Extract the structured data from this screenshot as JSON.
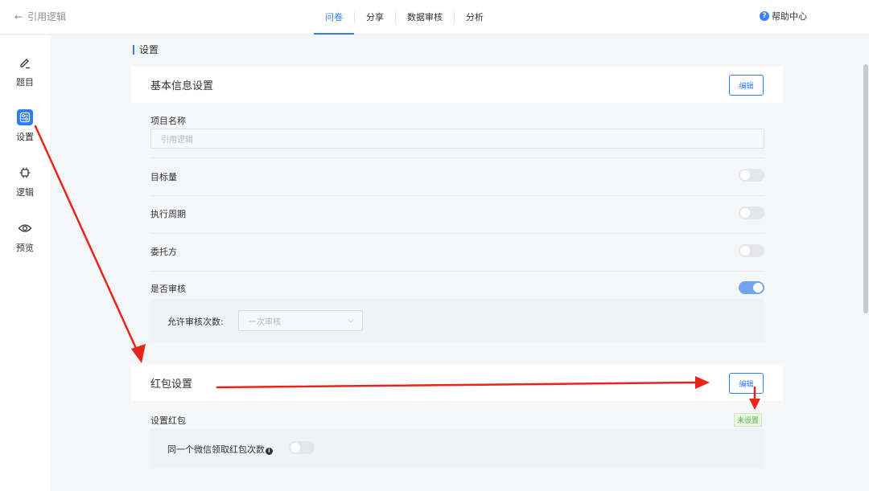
{
  "header": {
    "back_label": "引用逻辑",
    "tabs": [
      {
        "label": "问卷",
        "active": true
      },
      {
        "label": "分享",
        "active": false
      },
      {
        "label": "数据审核",
        "active": false
      },
      {
        "label": "分析",
        "active": false
      }
    ],
    "help_label": "帮助中心"
  },
  "sidebar": {
    "items": [
      {
        "label": "题目",
        "icon": "pencil-icon"
      },
      {
        "label": "设置",
        "icon": "settings-panel-icon",
        "active": true
      },
      {
        "label": "逻辑",
        "icon": "chip-icon"
      },
      {
        "label": "预览",
        "icon": "eye-icon"
      }
    ]
  },
  "main": {
    "section_title": "设置",
    "basic": {
      "title": "基本信息设置",
      "edit_label": "编辑",
      "project_name_label": "项目名称",
      "project_name_placeholder": "引用逻辑",
      "target_label": "目标量",
      "target_on": false,
      "cycle_label": "执行周期",
      "cycle_on": false,
      "client_label": "委托方",
      "client_on": false,
      "review_label": "是否审核",
      "review_on": true,
      "review_times_label": "允许审核次数:",
      "review_times_value": "一次审核"
    },
    "redpacket": {
      "title": "红包设置",
      "edit_label": "编辑",
      "set_label": "设置红包",
      "status_badge": "未设置",
      "wechat_times_label": "同一个微信领取红包次数",
      "wechat_times_on": false
    }
  },
  "colors": {
    "accent": "#2d7df6",
    "annotation_arrow": "#e8251b",
    "badge_green": "#56b64a"
  }
}
